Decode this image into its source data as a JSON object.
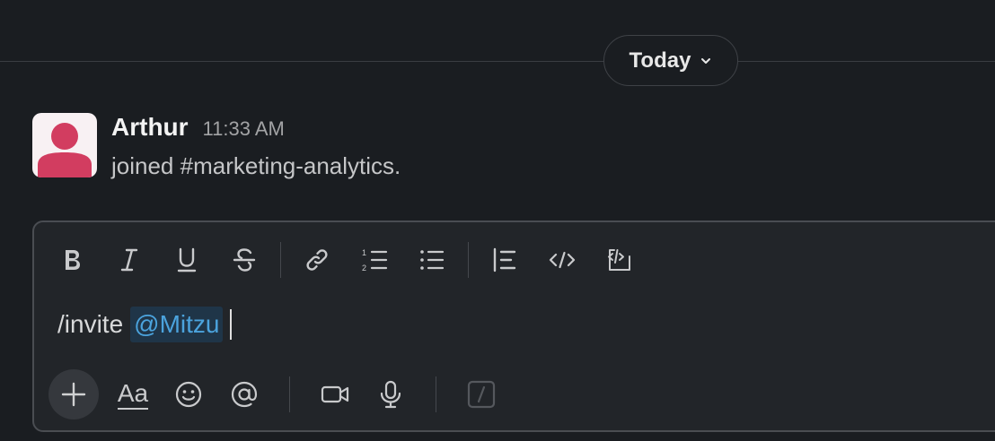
{
  "day_divider": {
    "label": "Today"
  },
  "message": {
    "author": "Arthur",
    "time": "11:33 AM",
    "text": "joined #marketing-analytics."
  },
  "composer": {
    "text_before": "/invite",
    "mention": "@Mitzu",
    "bottom": {
      "format_label": "Aa"
    }
  },
  "colors": {
    "background": "#1a1d21",
    "composer_bg": "#222529",
    "mention_fg": "#4ba3dd",
    "mention_bg": "#1f3548",
    "avatar_accent": "#d23d60"
  },
  "icons": {
    "formatting": [
      "bold-icon",
      "italic-icon",
      "underline-icon",
      "strikethrough-icon",
      "link-icon",
      "ordered-list-icon",
      "bulleted-list-icon",
      "blockquote-icon",
      "code-icon",
      "code-block-icon"
    ],
    "bottom": [
      "plus-icon",
      "emoji-icon",
      "mention-icon",
      "video-icon",
      "microphone-icon",
      "shortcuts-icon"
    ]
  }
}
